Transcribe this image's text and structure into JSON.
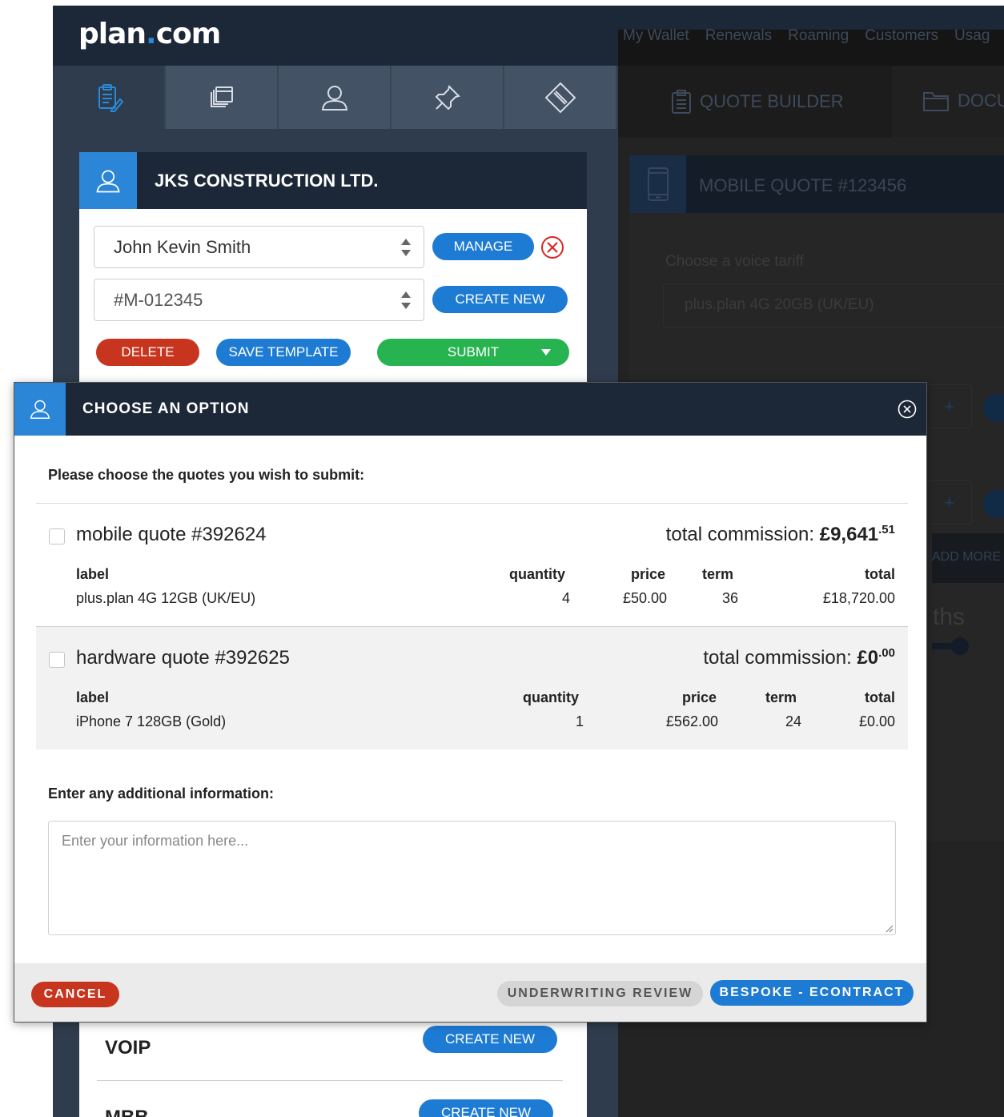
{
  "app": {
    "logo_main": "plan",
    "logo_dot": ".",
    "logo_tld": "com",
    "top_nav": [
      "My Wallet",
      "Renewals",
      "Roaming",
      "Customers",
      "Usag"
    ]
  },
  "left_panel": {
    "icon_tabs": [
      "quote-icon",
      "documents-icon",
      "user-icon",
      "pin-icon",
      "ticket-icon"
    ],
    "company": {
      "name": "JKS CONSTRUCTION LTD.",
      "contact_value": "John Kevin Smith",
      "account_value": "#M-012345",
      "manage_label": "MANAGE",
      "create_new_label": "CREATE NEW",
      "delete_label": "DELETE",
      "save_template_label": "SAVE TEMPLATE",
      "submit_label": "SUBMIT"
    },
    "products": [
      {
        "name": "VOIP",
        "button": "CREATE NEW"
      },
      {
        "name": "MBB",
        "button": "CREATE NEW"
      }
    ]
  },
  "right_panel": {
    "tabs": [
      "QUOTE BUILDER",
      "DOCU"
    ],
    "quote_title": "MOBILE QUOTE #123456",
    "tariff_label": "Choose a voice tariff",
    "tariff_value": "plus.plan 4G 20GB (UK/EU)",
    "plus": "+",
    "add_more": "ADD MORE S",
    "months_fragment": "ths"
  },
  "modal": {
    "title": "CHOOSE AN OPTION",
    "prompt": "Please choose the quotes you wish to submit:",
    "commission_prefix": "total commission: ",
    "quotes": [
      {
        "title": "mobile quote #392624",
        "commission_main": "£9,641",
        "commission_sup": ".51",
        "headers": {
          "label": "label",
          "quantity": "quantity",
          "price": "price",
          "term": "term",
          "total": "total"
        },
        "row": {
          "label": "plus.plan 4G 12GB (UK/EU)",
          "quantity": "4",
          "price": "£50.00",
          "term": "36",
          "total": "£18,720.00"
        }
      },
      {
        "title": "hardware quote #392625",
        "commission_main": "£0",
        "commission_sup": ".00",
        "headers": {
          "label": "label",
          "quantity": "quantity",
          "price": "price",
          "term": "term",
          "total": "total"
        },
        "row": {
          "label": "iPhone 7 128GB (Gold)",
          "quantity": "1",
          "price": "£562.00",
          "term": "24",
          "total": "£0.00"
        }
      }
    ],
    "info_label": "Enter any additional information:",
    "info_placeholder": "Enter your information here...",
    "cancel_label": "CANCEL",
    "underwriting_label": "UNDERWRITING REVIEW",
    "bespoke_label": "BESPOKE - ECONTRACT"
  },
  "colors": {
    "navy": "#1c2838",
    "accent_blue": "#2b86d8",
    "button_blue": "#1e7bd4",
    "danger_red": "#c8351f",
    "success_green": "#27b34f"
  }
}
